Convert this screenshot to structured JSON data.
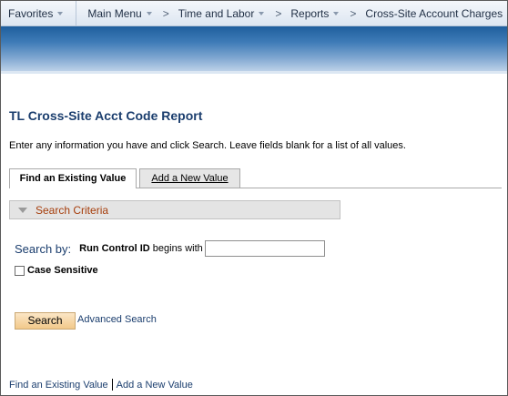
{
  "menubar": {
    "favorites": "Favorites",
    "main_menu": "Main Menu",
    "time_and_labor": "Time and Labor",
    "reports": "Reports",
    "current_page": "Cross-Site Account Charges"
  },
  "page": {
    "title": "TL Cross-Site Acct Code Report",
    "instructions": "Enter any information you have and click Search. Leave fields blank for a list of all values."
  },
  "tabs": {
    "find_existing": "Find an Existing Value",
    "add_new": "Add a New Value"
  },
  "criteria": {
    "label": "Search Criteria"
  },
  "search": {
    "search_by_label": "Search by:",
    "field_label": "Run Control ID",
    "operator": "begins with",
    "value": "",
    "case_sensitive_label": "Case Sensitive",
    "case_sensitive_checked": false
  },
  "buttons": {
    "search": "Search",
    "advanced_search": "Advanced Search"
  },
  "footer": {
    "find_existing": "Find an Existing Value",
    "add_new": "Add a New Value"
  },
  "colors": {
    "header_blue": "#1f5f9d",
    "title_text": "#1b3e6e",
    "criteria_text": "#a63e0c",
    "search_button": "#f2c98a"
  }
}
